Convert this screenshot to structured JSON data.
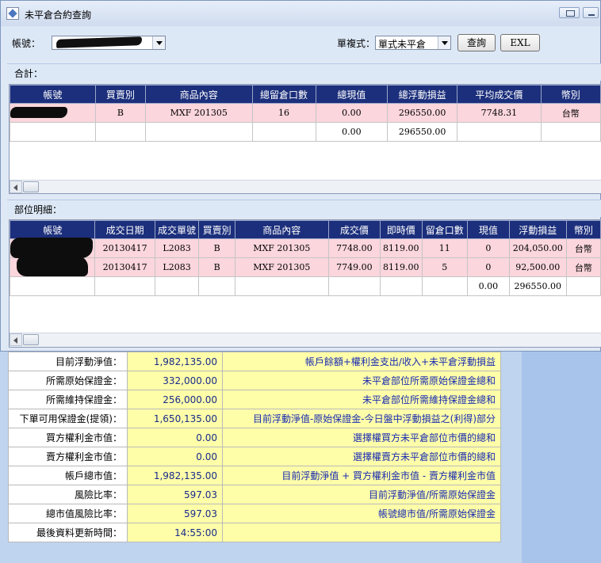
{
  "window": {
    "title": "未平倉合約查詢"
  },
  "toolbar": {
    "account_label": "帳號：",
    "mode_label": "單複式：",
    "mode_value": "單式未平倉",
    "query_button": "查詢",
    "exl_button": "EXL"
  },
  "summary": {
    "section_label": "合計：",
    "columns": [
      "帳號",
      "買賣別",
      "商品內容",
      "總留倉口數",
      "總現值",
      "總浮動損益",
      "平均成交價",
      "幣別"
    ],
    "rows": [
      [
        "",
        "B",
        "MXF 201305",
        "16",
        "0.00",
        "296550.00",
        "7748.31",
        "台幣"
      ],
      [
        "",
        "",
        "",
        "",
        "0.00",
        "296550.00",
        "",
        ""
      ]
    ]
  },
  "detail": {
    "section_label": "部位明細：",
    "columns": [
      "帳號",
      "成交日期",
      "成交單號",
      "買賣別",
      "商品內容",
      "成交價",
      "即時價",
      "留倉口數",
      "現值",
      "浮動損益",
      "幣別"
    ],
    "rows": [
      [
        "",
        "20130417",
        "L2083",
        "B",
        "MXF 201305",
        "7748.00",
        "8119.00",
        "11",
        "0",
        "204,050.00",
        "台幣"
      ],
      [
        "",
        "20130417",
        "L2083",
        "B",
        "MXF 201305",
        "7749.00",
        "8119.00",
        "5",
        "0",
        "92,500.00",
        "台幣"
      ],
      [
        "",
        "",
        "",
        "",
        "",
        "",
        "",
        "",
        "0.00",
        "296550.00",
        ""
      ]
    ]
  },
  "info": [
    {
      "label": "目前浮動淨值：",
      "value": "1,982,135.00",
      "desc": "帳戶餘額+權利金支出/收入+未平倉浮動損益"
    },
    {
      "label": "所需原始保證金：",
      "value": "332,000.00",
      "desc": "未平倉部位所需原始保證金總和"
    },
    {
      "label": "所需維持保證金：",
      "value": "256,000.00",
      "desc": "未平倉部位所需維持保證金總和"
    },
    {
      "label": "下單可用保證金(提領)：",
      "value": "1,650,135.00",
      "desc": "目前浮動淨值-原始保證金-今日盤中浮動損益之(利得)部分"
    },
    {
      "label": "買方權利金市值：",
      "value": "0.00",
      "desc": "選擇權買方未平倉部位市價的總和"
    },
    {
      "label": "賣方權利金市值：",
      "value": "0.00",
      "desc": "選擇權賣方未平倉部位市價的總和"
    },
    {
      "label": "帳戶總市值：",
      "value": "1,982,135.00",
      "desc": "目前浮動淨值 + 買方權利金市值 - 賣方權利金市值"
    },
    {
      "label": "風險比率：",
      "value": "597.03",
      "desc": "目前浮動淨值/所需原始保證金"
    },
    {
      "label": "總市值風險比率：",
      "value": "597.03",
      "desc": "帳號總市值/所需原始保證金"
    },
    {
      "label": "最後資料更新時間：",
      "value": "14:55:00",
      "desc": ""
    }
  ],
  "colors": {
    "header_bg": "#1c2f7c",
    "row_pink": "#fbd6dd",
    "info_yellow": "#fefea9",
    "desc_blue": "#1a2bb0"
  },
  "icons": {
    "app": "app-window-icon",
    "restore": "restore-icon",
    "minimize": "minimize-icon",
    "dropdown": "chevron-down-icon",
    "scroll_left": "arrow-left-icon"
  }
}
